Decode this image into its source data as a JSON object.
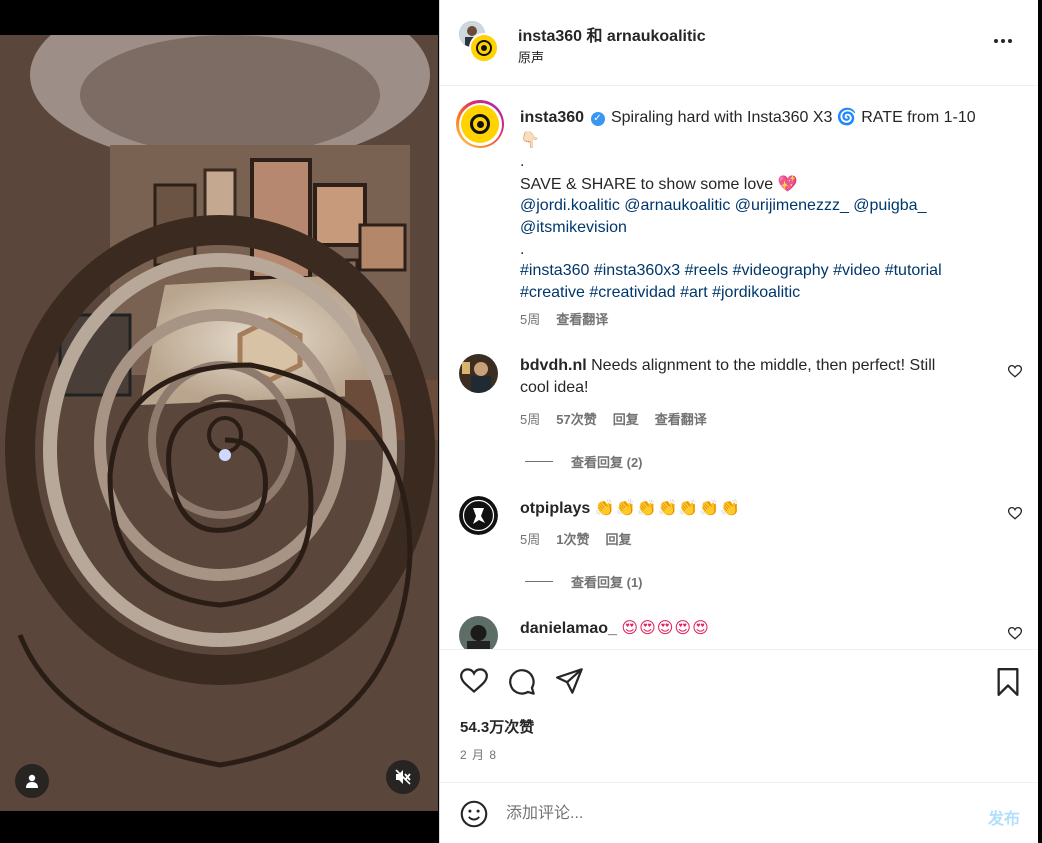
{
  "header": {
    "title": "insta360 和 arnaukoalitic",
    "subtitle": "原声",
    "more_icon": "more-horizontal-icon"
  },
  "caption": {
    "username": "insta360",
    "text_line1": "Spiraling hard with Insta360 X3",
    "text_line1b": "RATE from 1-10",
    "line2": ".",
    "line3": "SAVE & SHARE to show some love",
    "mentions_line1": "@jordi.koalitic @arnaukoalitic @urijimenezzz_ @puigba_",
    "mentions_line2": "@itsmikevision",
    "dot2": ".",
    "hashtags_line1": "#insta360 #insta360x3 #reels #videography #video #tutorial",
    "hashtags_line2": "#creative #creatividad #art #jordikoalitic",
    "time": "5周",
    "translate": "查看翻译"
  },
  "comments": [
    {
      "username": "bdvdh.nl",
      "text_line1": "Needs alignment to the middle, then perfect! Still",
      "text_line2": "cool idea!",
      "time": "5周",
      "likes": "57次赞",
      "reply": "回复",
      "translate": "查看翻译",
      "view_replies": "查看回复 (2)"
    },
    {
      "username": "otpiplays",
      "text": "👏👏👏👏👏👏👏",
      "time": "5周",
      "likes": "1次赞",
      "reply": "回复",
      "view_replies": "查看回复 (1)"
    },
    {
      "username": "danielamao_",
      "text": "😍😍😍😍😍"
    }
  ],
  "actions": {
    "likes": "54.3万次赞",
    "date": "2 月 8"
  },
  "composer": {
    "placeholder": "添加评论...",
    "post": "发布"
  },
  "colors": {
    "brand_yellow": "#ffd200",
    "link": "#00376b",
    "muted": "#737373",
    "post_disabled": "#b2dffc"
  }
}
